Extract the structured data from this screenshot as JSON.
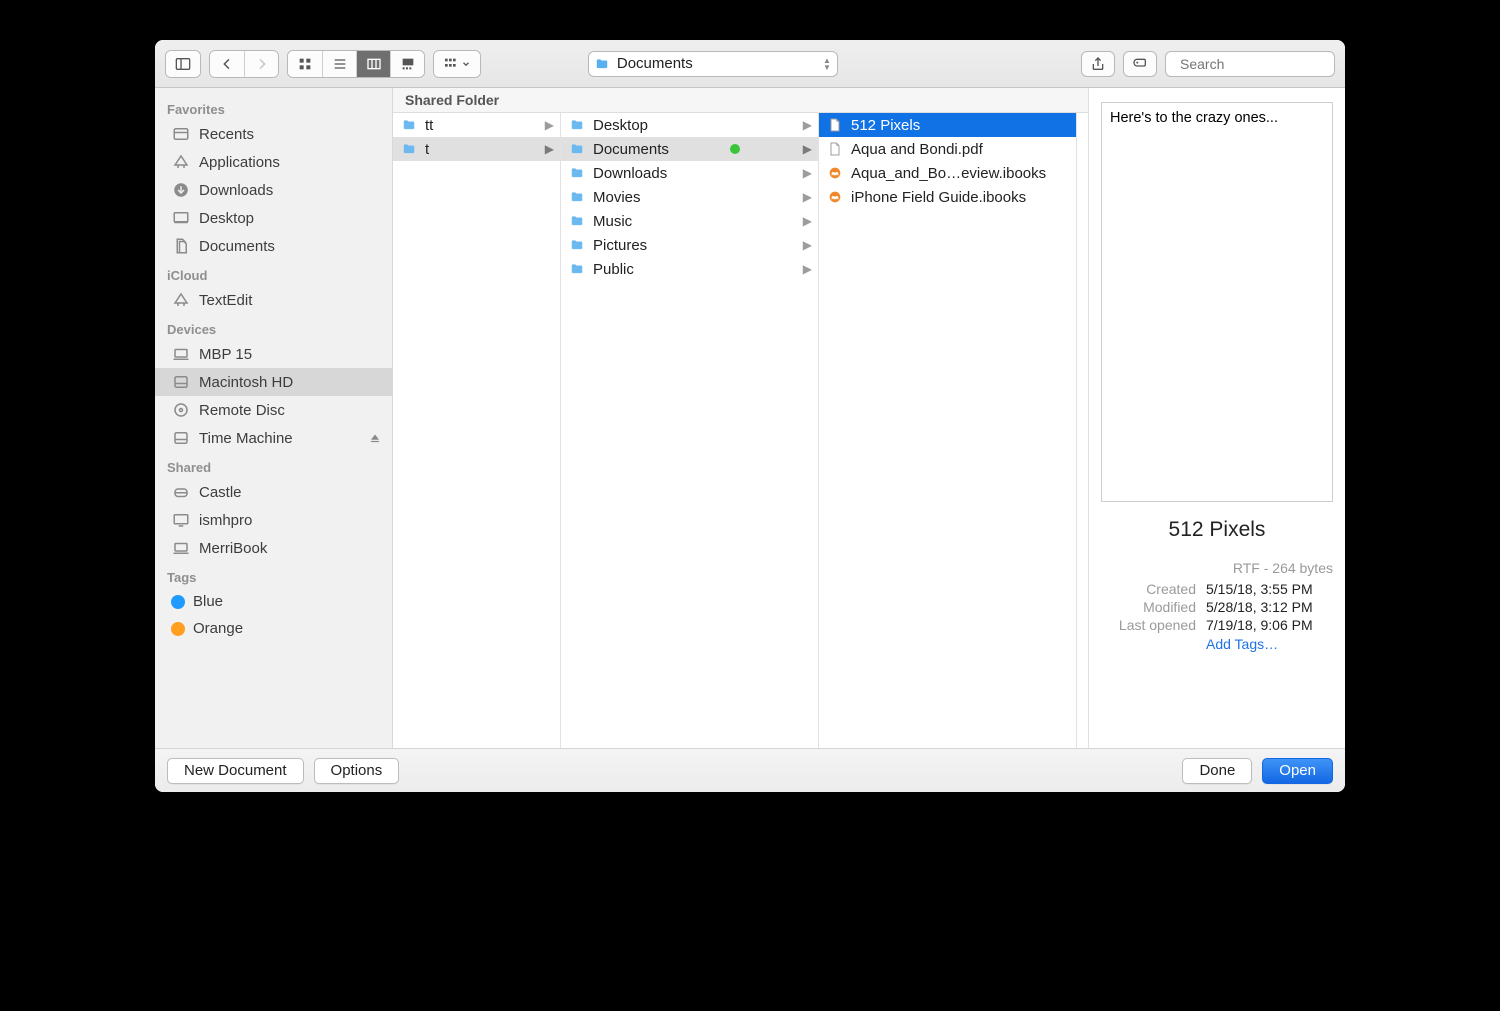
{
  "toolbar": {
    "path_label": "Documents",
    "search_placeholder": "Search"
  },
  "sidebar": {
    "sections": [
      {
        "title": "Favorites",
        "items": [
          {
            "label": "Recents",
            "icon": "recents"
          },
          {
            "label": "Applications",
            "icon": "apps"
          },
          {
            "label": "Downloads",
            "icon": "downloads"
          },
          {
            "label": "Desktop",
            "icon": "desktop"
          },
          {
            "label": "Documents",
            "icon": "documents"
          }
        ]
      },
      {
        "title": "iCloud",
        "items": [
          {
            "label": "TextEdit",
            "icon": "apps"
          }
        ]
      },
      {
        "title": "Devices",
        "items": [
          {
            "label": "MBP 15",
            "icon": "laptop"
          },
          {
            "label": "Macintosh HD",
            "icon": "disk",
            "selected": true
          },
          {
            "label": "Remote Disc",
            "icon": "optical"
          },
          {
            "label": "Time Machine",
            "icon": "disk",
            "eject": true
          }
        ]
      },
      {
        "title": "Shared",
        "items": [
          {
            "label": "Castle",
            "icon": "server"
          },
          {
            "label": "ismhpro",
            "icon": "display"
          },
          {
            "label": "MerriBook",
            "icon": "laptop"
          }
        ]
      },
      {
        "title": "Tags",
        "items": [
          {
            "label": "Blue",
            "icon": "tag",
            "color": "#1f9bff"
          },
          {
            "label": "Orange",
            "icon": "tag",
            "color": "#ff9e1f"
          }
        ]
      }
    ]
  },
  "browser": {
    "path_header": "Shared Folder",
    "columns": [
      [
        {
          "label": "tt",
          "kind": "folder",
          "has_children": true
        },
        {
          "label": "t",
          "kind": "folder",
          "has_children": true,
          "selected": "path"
        }
      ],
      [
        {
          "label": "Desktop",
          "kind": "folder",
          "has_children": true
        },
        {
          "label": "Documents",
          "kind": "folder",
          "has_children": true,
          "tag": "green",
          "selected": "path"
        },
        {
          "label": "Downloads",
          "kind": "folder",
          "has_children": true
        },
        {
          "label": "Movies",
          "kind": "folder",
          "has_children": true
        },
        {
          "label": "Music",
          "kind": "folder",
          "has_children": true
        },
        {
          "label": "Pictures",
          "kind": "folder",
          "has_children": true
        },
        {
          "label": "Public",
          "kind": "folder",
          "has_children": true
        }
      ],
      [
        {
          "label": "512 Pixels",
          "kind": "doc",
          "selected": "focus"
        },
        {
          "label": "Aqua and Bondi.pdf",
          "kind": "doc"
        },
        {
          "label": "Aqua_and_Bo…eview.ibooks",
          "kind": "ibook"
        },
        {
          "label": "iPhone Field Guide.ibooks",
          "kind": "ibook"
        }
      ]
    ]
  },
  "preview": {
    "content": "Here's to the crazy ones...",
    "title": "512 Pixels",
    "type_line": "RTF - 264 bytes",
    "meta": [
      {
        "k": "Created",
        "v": "5/15/18, 3:55 PM"
      },
      {
        "k": "Modified",
        "v": "5/28/18, 3:12 PM"
      },
      {
        "k": "Last opened",
        "v": "7/19/18, 9:06 PM"
      }
    ],
    "add_tags": "Add Tags…"
  },
  "footer": {
    "new_document": "New Document",
    "options": "Options",
    "done": "Done",
    "open": "Open"
  }
}
